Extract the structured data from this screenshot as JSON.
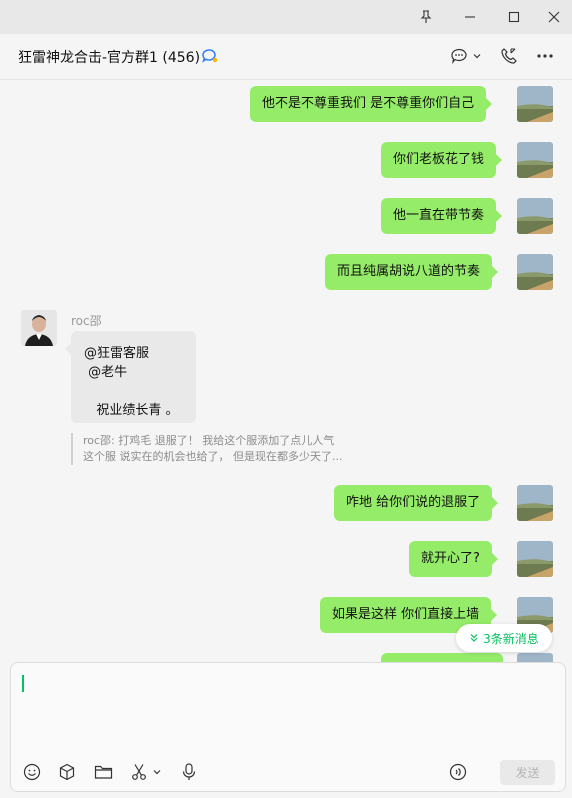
{
  "window": {
    "pin_icon": "pin-icon",
    "minimize_icon": "minimize-icon",
    "maximize_icon": "maximize-icon",
    "close_icon": "close-icon"
  },
  "header": {
    "title": "狂雷神龙合击-官方群1 (456)",
    "group_badge_icon": "group-chat-icon",
    "chat_icon": "chat-bubble-icon",
    "call_icon": "phone-icon",
    "more_icon": "more-icon"
  },
  "messages": {
    "m1": "他不是不尊重我们 是不尊重你们自己",
    "m2": "你们老板花了钱",
    "m3": "他一直在带节奏",
    "m4": "而且纯属胡说八道的节奏",
    "sender": "roc邵",
    "other_line1": "@狂雷客服",
    "other_line2": " @老牛",
    "other_line3": "   祝业绩长青 。",
    "quote_line1": "roc邵: 打鸡毛  退服了！  我给这个服添加了点儿人气",
    "quote_line2": "这个服  说实在的机会也给了，  但是现在都多少天了...",
    "m5": "咋地 给你们说的退服了",
    "m6": "就开心了?",
    "m7": "如果是这样 你们直接上墙"
  },
  "new_messages": "3条新消息",
  "input": {
    "value": "",
    "send_label": "发送"
  },
  "toolbar": {
    "emoji_icon": "emoji-icon",
    "favorites_icon": "cube-icon",
    "file_icon": "folder-icon",
    "screenshot_icon": "scissors-icon",
    "voice_icon": "microphone-icon",
    "voice_input_icon": "voice-input-icon"
  }
}
